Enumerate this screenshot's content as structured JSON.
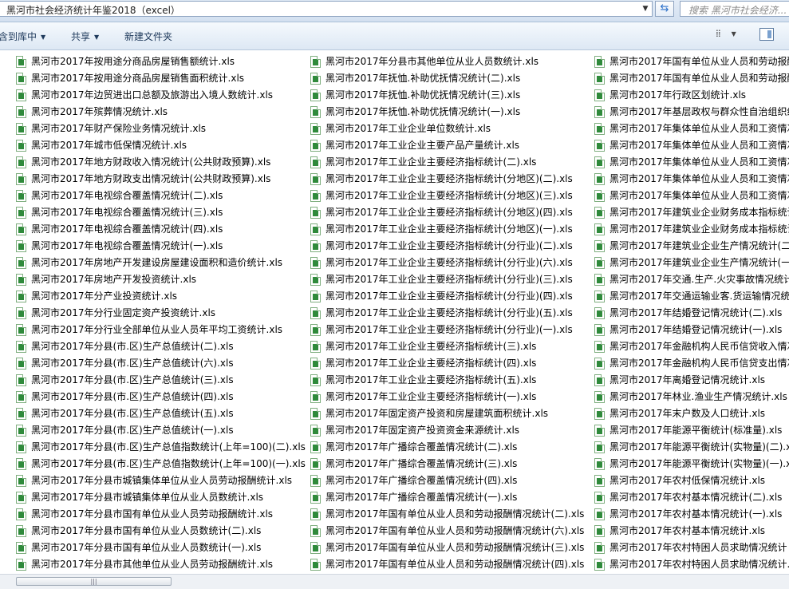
{
  "address": {
    "path": "黑河市社会经济统计年鉴2018（excel）"
  },
  "search": {
    "placeholder": "搜索 黑河市社会经济..."
  },
  "toolbar": {
    "include_library": "含到库中",
    "share": "共享",
    "new_folder": "新建文件夹"
  },
  "columns": [
    [
      "黑河市2017年按用途分商品房屋销售额统计.xls",
      "黑河市2017年按用途分商品房屋销售面积统计.xls",
      "黑河市2017年边贸进出口总额及旅游出入境人数统计.xls",
      "黑河市2017年殡葬情况统计.xls",
      "黑河市2017年财产保险业务情况统计.xls",
      "黑河市2017年城市低保情况统计.xls",
      "黑河市2017年地方财政收入情况统计(公共财政预算).xls",
      "黑河市2017年地方财政支出情况统计(公共财政预算).xls",
      "黑河市2017年电视综合覆盖情况统计(二).xls",
      "黑河市2017年电视综合覆盖情况统计(三).xls",
      "黑河市2017年电视综合覆盖情况统计(四).xls",
      "黑河市2017年电视综合覆盖情况统计(一).xls",
      "黑河市2017年房地产开发建设房屋建设面积和造价统计.xls",
      "黑河市2017年房地产开发投资统计.xls",
      "黑河市2017年分产业投资统计.xls",
      "黑河市2017年分行业固定资产投资统计.xls",
      "黑河市2017年分行业全部单位从业人员年平均工资统计.xls",
      "黑河市2017年分县(市.区)生产总值统计(二).xls",
      "黑河市2017年分县(市.区)生产总值统计(六).xls",
      "黑河市2017年分县(市.区)生产总值统计(三).xls",
      "黑河市2017年分县(市.区)生产总值统计(四).xls",
      "黑河市2017年分县(市.区)生产总值统计(五).xls",
      "黑河市2017年分县(市.区)生产总值统计(一).xls",
      "黑河市2017年分县(市.区)生产总值指数统计(上年=100)(二).xls",
      "黑河市2017年分县(市.区)生产总值指数统计(上年=100)(一).xls",
      "黑河市2017年分县市城镇集体单位从业人员劳动报酬统计.xls",
      "黑河市2017年分县市城镇集体单位从业人员数统计.xls",
      "黑河市2017年分县市国有单位从业人员劳动报酬统计.xls",
      "黑河市2017年分县市国有单位从业人员数统计(二).xls",
      "黑河市2017年分县市国有单位从业人员数统计(一).xls",
      "黑河市2017年分县市其他单位从业人员劳动报酬统计.xls"
    ],
    [
      "黑河市2017年分县市其他单位从业人员数统计.xls",
      "黑河市2017年抚恤.补助优抚情况统计(二).xls",
      "黑河市2017年抚恤.补助优抚情况统计(三).xls",
      "黑河市2017年抚恤.补助优抚情况统计(一).xls",
      "黑河市2017年工业企业单位数统计.xls",
      "黑河市2017年工业企业主要产品产量统计.xls",
      "黑河市2017年工业企业主要经济指标统计(二).xls",
      "黑河市2017年工业企业主要经济指标统计(分地区)(二).xls",
      "黑河市2017年工业企业主要经济指标统计(分地区)(三).xls",
      "黑河市2017年工业企业主要经济指标统计(分地区)(四).xls",
      "黑河市2017年工业企业主要经济指标统计(分地区)(一).xls",
      "黑河市2017年工业企业主要经济指标统计(分行业)(二).xls",
      "黑河市2017年工业企业主要经济指标统计(分行业)(六).xls",
      "黑河市2017年工业企业主要经济指标统计(分行业)(三).xls",
      "黑河市2017年工业企业主要经济指标统计(分行业)(四).xls",
      "黑河市2017年工业企业主要经济指标统计(分行业)(五).xls",
      "黑河市2017年工业企业主要经济指标统计(分行业)(一).xls",
      "黑河市2017年工业企业主要经济指标统计(三).xls",
      "黑河市2017年工业企业主要经济指标统计(四).xls",
      "黑河市2017年工业企业主要经济指标统计(五).xls",
      "黑河市2017年工业企业主要经济指标统计(一).xls",
      "黑河市2017年固定资产投资和房屋建筑面积统计.xls",
      "黑河市2017年固定资产投资资金来源统计.xls",
      "黑河市2017年广播综合覆盖情况统计(二).xls",
      "黑河市2017年广播综合覆盖情况统计(三).xls",
      "黑河市2017年广播综合覆盖情况统计(四).xls",
      "黑河市2017年广播综合覆盖情况统计(一).xls",
      "黑河市2017年国有单位从业人员和劳动报酬情况统计(二).xls",
      "黑河市2017年国有单位从业人员和劳动报酬情况统计(六).xls",
      "黑河市2017年国有单位从业人员和劳动报酬情况统计(三).xls",
      "黑河市2017年国有单位从业人员和劳动报酬情况统计(四).xls"
    ],
    [
      "黑河市2017年国有单位从业人员和劳动报酬",
      "黑河市2017年国有单位从业人员和劳动报酬",
      "黑河市2017年行政区划统计.xls",
      "黑河市2017年基层政权与群众性自治组织统",
      "黑河市2017年集体单位从业人员和工资情况",
      "黑河市2017年集体单位从业人员和工资情况",
      "黑河市2017年集体单位从业人员和工资情况",
      "黑河市2017年集体单位从业人员和工资情况",
      "黑河市2017年集体单位从业人员和工资情况",
      "黑河市2017年建筑业企业财务成本指标统计",
      "黑河市2017年建筑业企业财务成本指标统计",
      "黑河市2017年建筑业企业生产情况统计(二)",
      "黑河市2017年建筑业企业生产情况统计(一)",
      "黑河市2017年交通.生产.火灾事故情况统计",
      "黑河市2017年交通运输业客.货运输情况统计",
      "黑河市2017年结婚登记情况统计(二).xls",
      "黑河市2017年结婚登记情况统计(一).xls",
      "黑河市2017年金融机构人民币信贷收入情况",
      "黑河市2017年金融机构人民币信贷支出情况",
      "黑河市2017年离婚登记情况统计.xls",
      "黑河市2017年林业.渔业生产情况统计.xls",
      "黑河市2017年末户数及人口统计.xls",
      "黑河市2017年能源平衡统计(标准量).xls",
      "黑河市2017年能源平衡统计(实物量)(二).xl",
      "黑河市2017年能源平衡统计(实物量)(一).xl",
      "黑河市2017年农村低保情况统计.xls",
      "黑河市2017年农村基本情况统计(二).xls",
      "黑河市2017年农村基本情况统计(一).xls",
      "黑河市2017年农村基本情况统计.xls",
      "黑河市2017年农村特困人员求助情况统计",
      "黑河市2017年农村特困人员求助情况统计.x"
    ]
  ],
  "scrollbar": {
    "grip": "|||"
  }
}
